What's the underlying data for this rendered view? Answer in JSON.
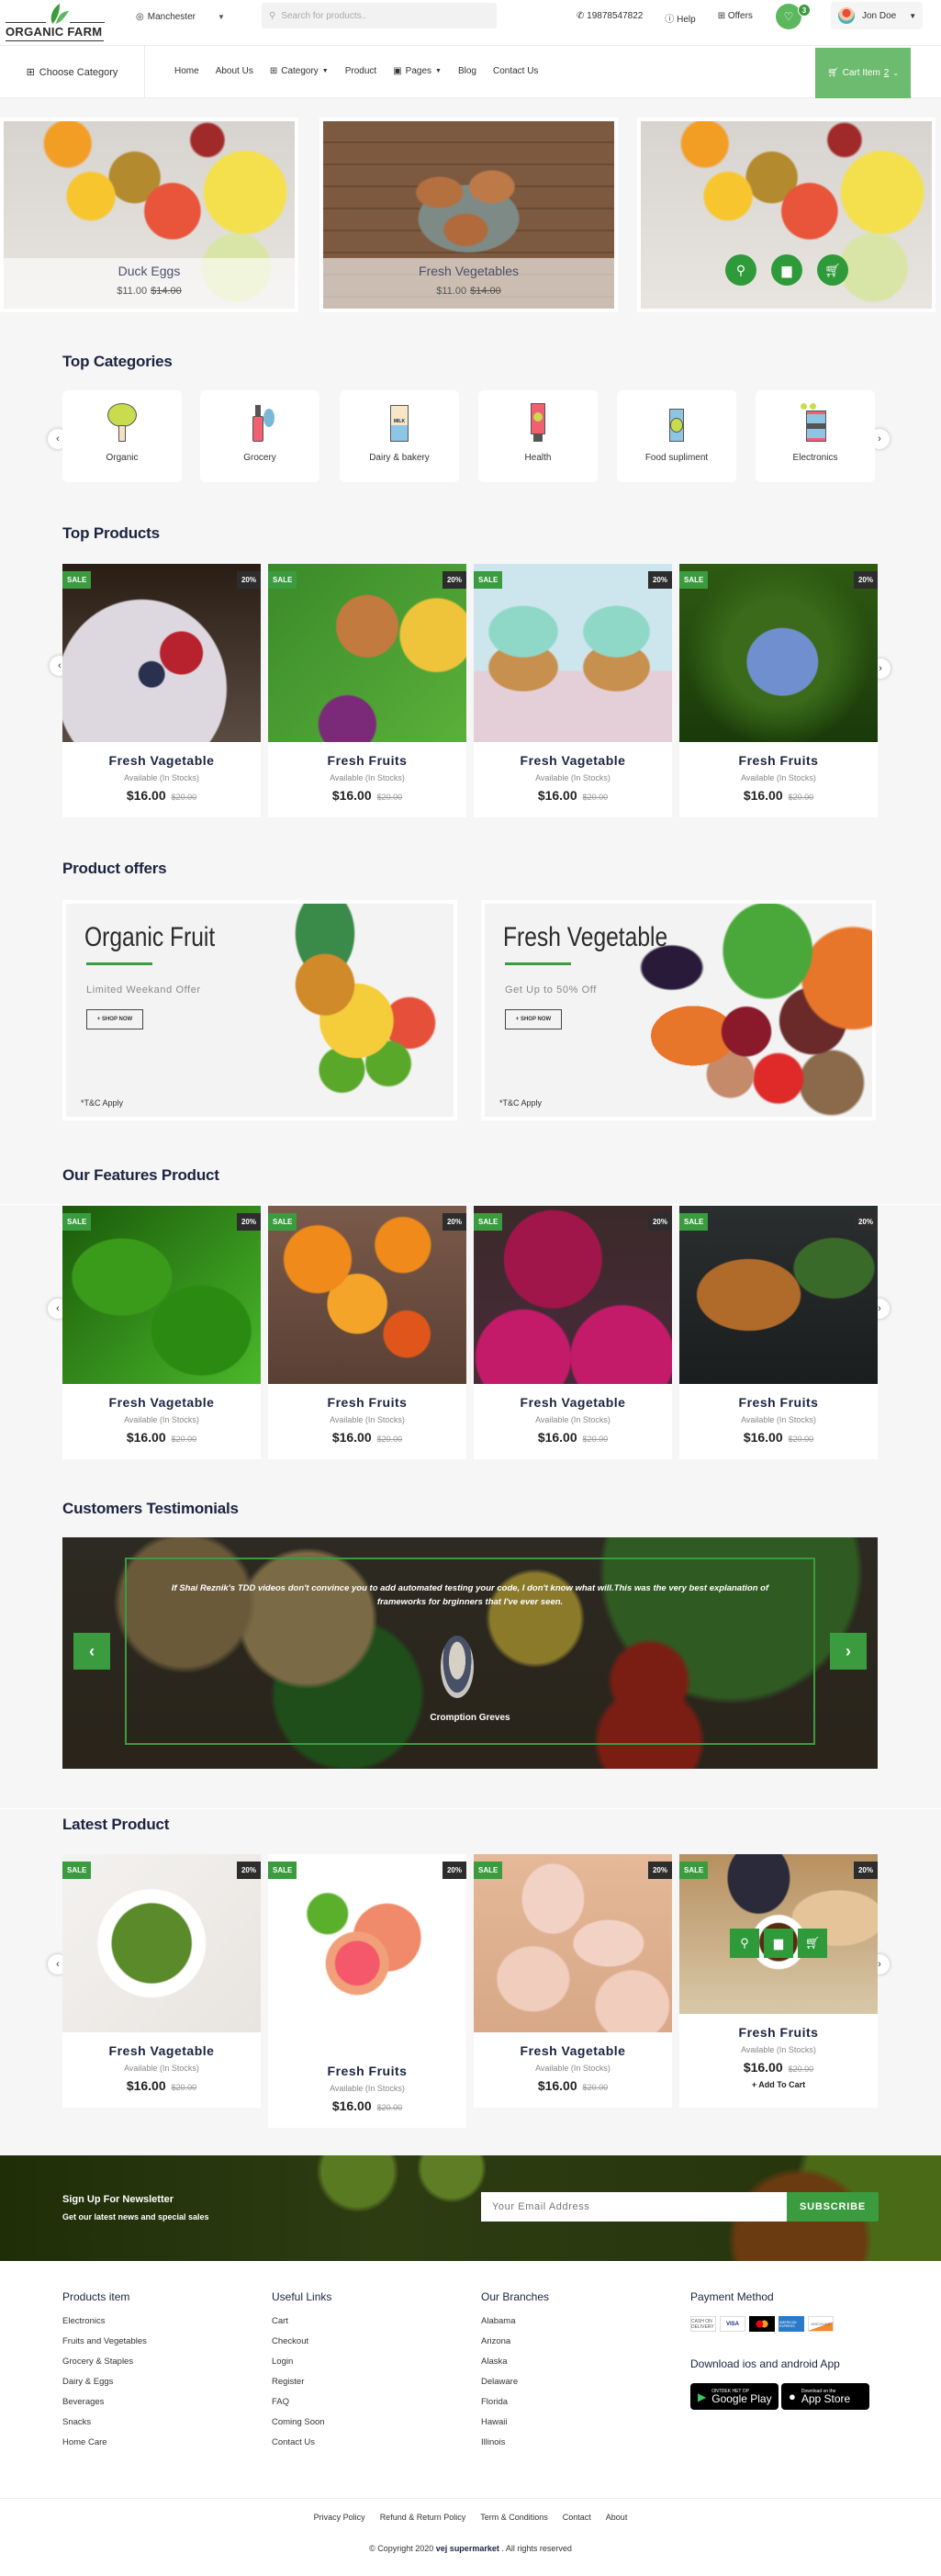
{
  "header": {
    "logo_text": "ORGANIC FARM",
    "location": "Manchester",
    "search_placeholder": "Search for products..",
    "phone": "19878547822",
    "help": "Help",
    "offers": "Offers",
    "wishlist_count": "3",
    "user_name": "Jon Doe"
  },
  "nav": {
    "choose_category": "Choose Category",
    "items": [
      "Home",
      "About Us",
      "Category",
      "Product",
      "Pages",
      "Blog",
      "Contact Us"
    ],
    "cart_label": "Cart Item",
    "cart_count": "2"
  },
  "banner": [
    {
      "title": "Duck Eggs",
      "price": "$11.00",
      "old_price": "$14.00"
    },
    {
      "title": "Fresh Vegetables",
      "price": "$11.00",
      "old_price": "$14.00"
    }
  ],
  "sections": {
    "top_categories": "Top Categories",
    "top_products": "Top Products",
    "product_offers": "Product offers",
    "features": "Our Features Product",
    "testimonials": "Customers Testimonials",
    "latest": "Latest Product"
  },
  "categories": [
    {
      "label": "Organic",
      "icon": "broccoli-icon"
    },
    {
      "label": "Grocery",
      "icon": "bottle-icon"
    },
    {
      "label": "Dairy & bakery",
      "icon": "milk-icon"
    },
    {
      "label": "Health",
      "icon": "tube-icon"
    },
    {
      "label": "Food supliment",
      "icon": "can-icon"
    },
    {
      "label": "Electronics",
      "icon": "tin-icon"
    }
  ],
  "badges": {
    "sale": "SALE",
    "discount": "20%"
  },
  "product_common": {
    "availability": "Available (In Stocks)",
    "price": "$16.00",
    "old_price": "$20.00",
    "add_to_cart": "+ Add To Cart"
  },
  "top_products": [
    {
      "name": "Fresh Vagetable",
      "image": "berry-cake"
    },
    {
      "name": "Fresh Fruits",
      "image": "tofu-salad"
    },
    {
      "name": "Fresh Vagetable",
      "image": "cupcakes"
    },
    {
      "name": "Fresh Fruits",
      "image": "blueberries"
    }
  ],
  "offers": [
    {
      "title": "Organic Fruit",
      "subtitle": "Limited Weekand Offer",
      "button": "+ SHOP NOW",
      "note": "*T&C Apply"
    },
    {
      "title": "Fresh Vegetable",
      "subtitle": "Get Up to 50% Off",
      "button": "+ SHOP NOW",
      "note": "*T&C Apply"
    }
  ],
  "features": [
    {
      "name": "Fresh Vagetable",
      "image": "spinach"
    },
    {
      "name": "Fresh Fruits",
      "image": "oranges"
    },
    {
      "name": "Fresh Vagetable",
      "image": "red-onions"
    },
    {
      "name": "Fresh Fruits",
      "image": "tart"
    }
  ],
  "testimonial": {
    "quote": "If Shai Reznik's TDD videos don't convince you to add automated testing your code, I don't know what will.This was the very best explanation of frameworks for brginners that I've ever seen.",
    "author": "Cromption Greves"
  },
  "latest": [
    {
      "name": "Fresh Vagetable",
      "image": "salad"
    },
    {
      "name": "Fresh Fruits",
      "image": "grapefruit"
    },
    {
      "name": "Fresh Vagetable",
      "image": "macarons"
    },
    {
      "name": "Fresh Fruits",
      "image": "cheese-board"
    }
  ],
  "newsletter": {
    "title": "Sign Up For Newsletter",
    "subtitle": "Get our latest news and special sales",
    "placeholder": "Your Email Address",
    "button": "SUBSCRIBE"
  },
  "footer": {
    "products_title": "Products item",
    "products": [
      "Electronics",
      "Fruits and Vegetables",
      "Grocery & Staples",
      "Dairy & Eggs",
      "Beverages",
      "Snacks",
      "Home Care"
    ],
    "links_title": "Useful Links",
    "links": [
      "Cart",
      "Checkout",
      "Login",
      "Register",
      "FAQ",
      "Coming Soon",
      "Contact Us"
    ],
    "branches_title": "Our Branches",
    "branches": [
      "Alabama",
      "Arizona",
      "Alaska",
      "Delaware",
      "Florida",
      "Hawaii",
      "Illinois"
    ],
    "payment_title": "Payment Method",
    "payment_methods": [
      "CASH ON DELIVERY",
      "VISA",
      "Mastercard",
      "AMERICAN EXPRESS",
      "DISCOVER"
    ],
    "app_title": "Download ios and android App",
    "google_small": "ONTDEK HET OP",
    "google_big": "Google Play",
    "apple_small": "Download on the",
    "apple_big": "App Store",
    "bottom_links": [
      "Privacy Policy",
      "Refund & Return Policy",
      "Term & Conditions",
      "Contact",
      "About"
    ],
    "copyright_prefix": "© Copyright 2020",
    "brand": "vej supermarket",
    "copyright_suffix": ". All rights reserved"
  }
}
